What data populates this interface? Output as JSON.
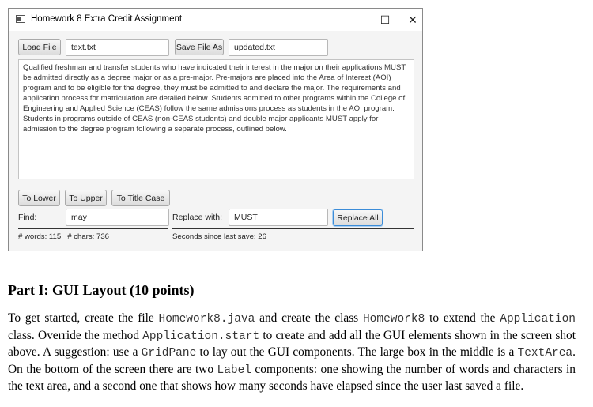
{
  "window": {
    "title": "Homework 8 Extra Credit Assignment",
    "minimize_glyph": "—",
    "maximize_glyph": "☐",
    "close_glyph": "✕"
  },
  "toolbar": {
    "load_label": "Load File",
    "load_filename": "text.txt",
    "save_label": "Save File As",
    "save_filename": "updated.txt"
  },
  "text_area": {
    "content": "Qualified freshman and transfer students who have indicated their interest in the major on their applications MUST be admitted directly as a degree major or as a pre-major. Pre-majors are placed into the Area of Interest (AOI) program and to be eligible for the degree, they must be admitted to and declare the major. The requirements and application process for matriculation are detailed below. Students admitted to other programs within the College of Engineering and Applied Science (CEAS) follow the same admissions process as students in the AOI program. Students in programs outside of CEAS (non-CEAS students) and double major applicants MUST apply for admission to the degree program following a separate process, outlined below."
  },
  "case_buttons": {
    "lower": "To Lower",
    "upper": "To Upper",
    "title": "To Title Case"
  },
  "find_replace": {
    "find_label": "Find:",
    "find_value": "may",
    "replace_label": "Replace with:",
    "replace_value": "MUST",
    "replace_all": "Replace All"
  },
  "status": {
    "words_chars": "# words: 115   # chars: 736",
    "seconds": "Seconds since last save: 26"
  },
  "document": {
    "heading": "Part I: GUI Layout (10 points)",
    "p1": "To get started, create the file ",
    "c1": "Homework8.java",
    "p2": " and create the class ",
    "c2": "Homework8",
    "p3": " to extend the ",
    "c3": "Application",
    "p4": " class. Override the method ",
    "c4": "Application.start",
    "p5": " to create and add all the GUI elements shown in the screen shot above. A suggestion: use a ",
    "c5": "GridPane",
    "p6": " to lay out the GUI components. The large box in the middle is a ",
    "c6": "TextArea",
    "p7": ". On the bottom of the screen there are two ",
    "c7": "Label",
    "p8": " components: one showing the number of words and characters in the text area, and a second one that shows how many seconds have elapsed since the user last saved a file."
  }
}
